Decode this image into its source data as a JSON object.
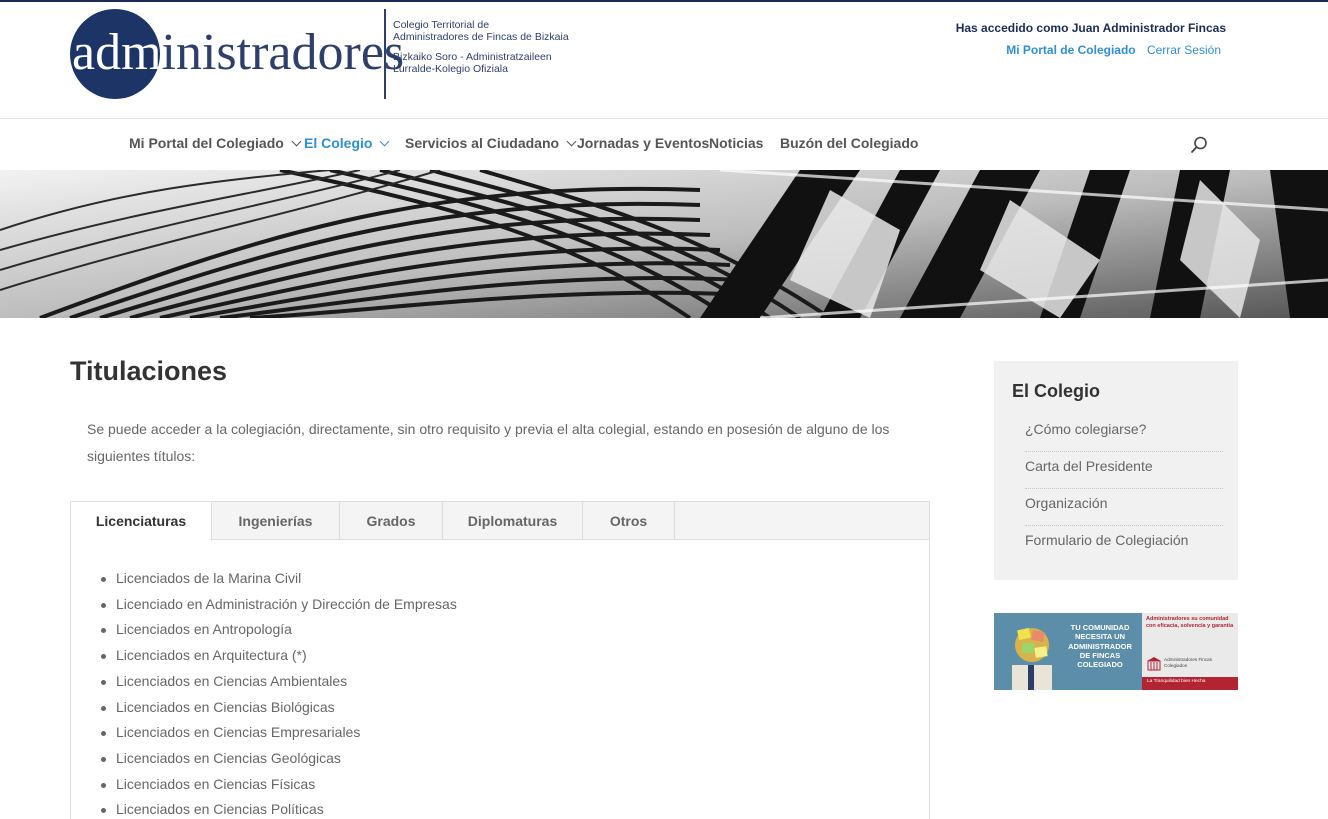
{
  "header": {
    "logo": {
      "word_part1": "adm",
      "word_part2": "inistradores",
      "line1": "Colegio Territorial de",
      "line2": "Administradores de Fincas de Bizkaia",
      "line3": "Bizkaiko Soro - Administratzaileen",
      "line4": "Lurralde-Kolegio Ofiziala"
    },
    "user_greeting": "Has accedido como Juan Administrador Fincas",
    "portal_link": "Mi Portal de Colegiado",
    "logout_link": "Cerrar Sesión"
  },
  "nav": {
    "items": [
      {
        "label": "Mi Portal del Colegiado",
        "dropdown": true,
        "active": false
      },
      {
        "label": "El Colegio",
        "dropdown": true,
        "active": true
      },
      {
        "label": "Servicios al Ciudadano",
        "dropdown": true,
        "active": false
      },
      {
        "label": "Jornadas y Eventos",
        "dropdown": false,
        "active": false
      },
      {
        "label": "Noticias",
        "dropdown": false,
        "active": false
      },
      {
        "label": "Buzón del Colegiado",
        "dropdown": false,
        "active": false
      }
    ],
    "search_icon": "search-icon"
  },
  "main": {
    "title": "Titulaciones",
    "intro": "Se puede acceder a la colegiación, directamente, sin otro requisito y previa el alta colegial, estando en posesión de alguno de los siguientes títulos:",
    "tabs": [
      {
        "label": "Licenciaturas",
        "active": true
      },
      {
        "label": "Ingenierías",
        "active": false
      },
      {
        "label": "Grados",
        "active": false
      },
      {
        "label": "Diplomaturas",
        "active": false
      },
      {
        "label": "Otros",
        "active": false
      }
    ],
    "list": [
      "Licenciados de la Marina Civil",
      "Licenciado en Administración y Dirección de Empresas",
      "Licenciados en Antropología",
      "Licenciados en Arquitectura (*)",
      "Licenciados en Ciencias Ambientales",
      "Licenciados en Ciencias Biológicas",
      "Licenciados en Ciencias Empresariales",
      "Licenciados en Ciencias Geológicas",
      "Licenciados en Ciencias Físicas",
      "Licenciados en Ciencias Políticas"
    ]
  },
  "sidebar": {
    "title": "El Colegio",
    "links": [
      "¿Cómo colegiarse?",
      "Carta del Presidente",
      "Organización",
      "Formulario de Colegiación"
    ]
  },
  "ad": {
    "headline": [
      "TU COMUNIDAD",
      "NECESITA UN",
      "ADMINISTRADOR",
      "DE FINCAS"
    ],
    "headline_last": "COLEGIADO",
    "tagline": "Administradores su comunidad con eficacia, solvencia y garantía",
    "mini": "Administradores Fincas Colegiados",
    "strip": "La Tranquilidad bien Hecha"
  },
  "colors": {
    "brand_navy": "#1c3466",
    "link_blue": "#2e8fd6",
    "ad_red": "#b32433"
  }
}
